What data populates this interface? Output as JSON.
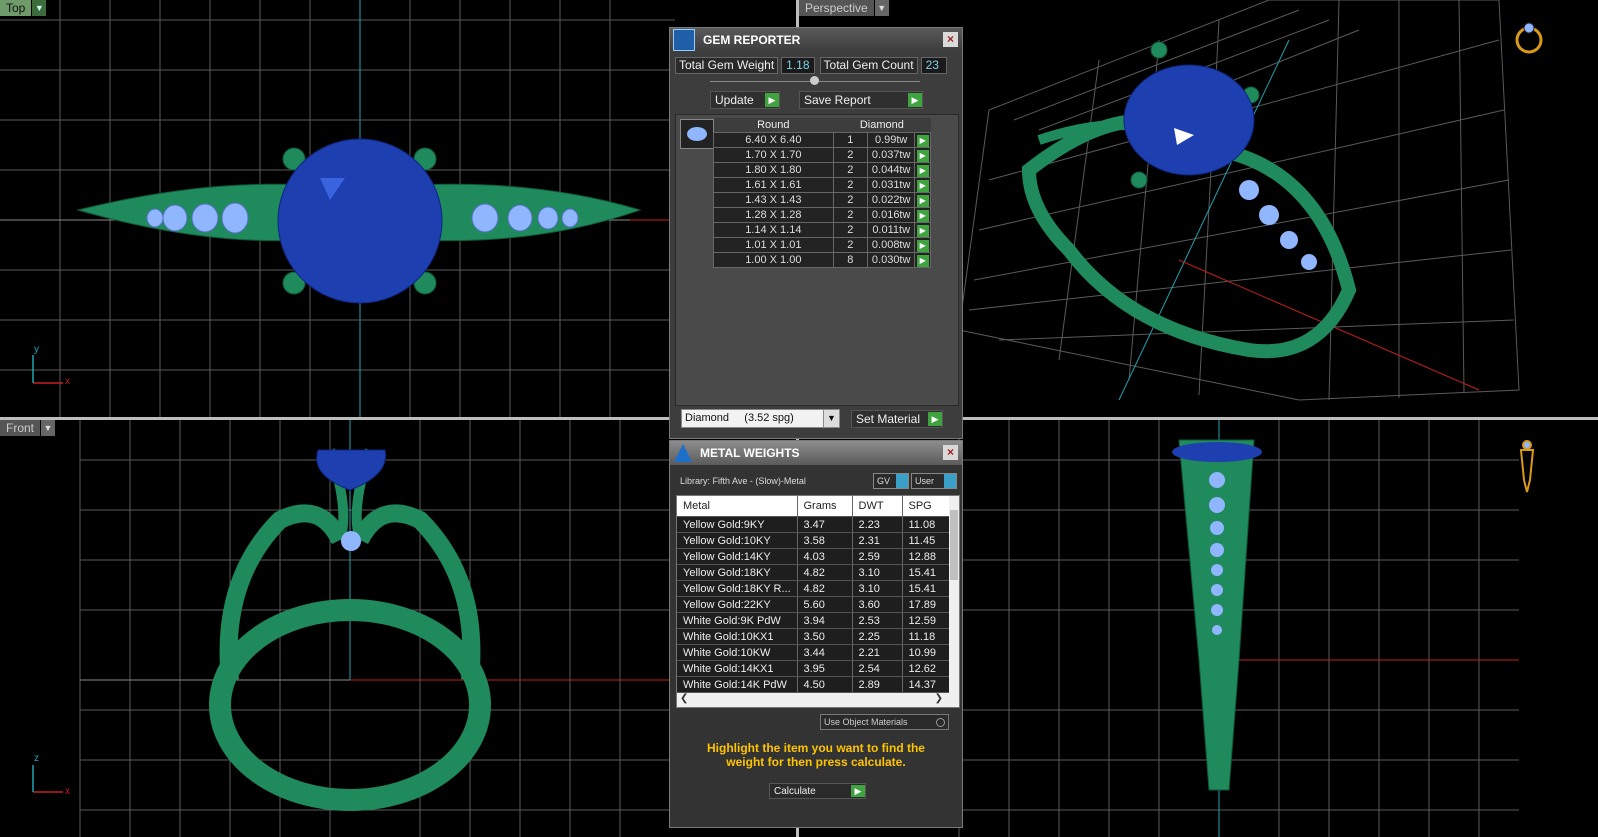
{
  "viewports": {
    "top": {
      "label": "Top",
      "axis_x": "x",
      "axis_y": "y"
    },
    "perspective": {
      "label": "Perspective"
    },
    "front": {
      "label": "Front",
      "axis_x": "x",
      "axis_y": "z"
    },
    "right": {
      "label": ""
    }
  },
  "gem_reporter": {
    "title": "GEM REPORTER",
    "total_weight_label": "Total Gem Weight",
    "total_weight_value": "1.18",
    "total_count_label": "Total Gem Count",
    "total_count_value": "23",
    "update_label": "Update",
    "save_label": "Save Report",
    "col_shape": "Round",
    "col_material": "Diamond",
    "rows": [
      {
        "size": "6.40 X 6.40",
        "count": "1",
        "weight": "0.99tw"
      },
      {
        "size": "1.70 X 1.70",
        "count": "2",
        "weight": "0.037tw"
      },
      {
        "size": "1.80 X 1.80",
        "count": "2",
        "weight": "0.044tw"
      },
      {
        "size": "1.61 X 1.61",
        "count": "2",
        "weight": "0.031tw"
      },
      {
        "size": "1.43 X 1.43",
        "count": "2",
        "weight": "0.022tw"
      },
      {
        "size": "1.28 X 1.28",
        "count": "2",
        "weight": "0.016tw"
      },
      {
        "size": "1.14 X 1.14",
        "count": "2",
        "weight": "0.011tw"
      },
      {
        "size": "1.01 X 1.01",
        "count": "2",
        "weight": "0.008tw"
      },
      {
        "size": "1.00 X 1.00",
        "count": "8",
        "weight": "0.030tw"
      }
    ],
    "material_select": "Diamond     (3.52 spg)",
    "set_material_label": "Set Material"
  },
  "metal_weights": {
    "title": "METAL WEIGHTS",
    "library": "Library: Fifth Ave - (Slow)-Metal",
    "gv_label": "GV",
    "user_label": "User",
    "columns": [
      "Metal",
      "Grams",
      "DWT",
      "SPG"
    ],
    "rows": [
      [
        "Yellow Gold:9KY",
        "3.47",
        "2.23",
        "11.08"
      ],
      [
        "Yellow Gold:10KY",
        "3.58",
        "2.31",
        "11.45"
      ],
      [
        "Yellow Gold:14KY",
        "4.03",
        "2.59",
        "12.88"
      ],
      [
        "Yellow Gold:18KY",
        "4.82",
        "3.10",
        "15.41"
      ],
      [
        "Yellow Gold:18KY R...",
        "4.82",
        "3.10",
        "15.41"
      ],
      [
        "Yellow Gold:22KY",
        "5.60",
        "3.60",
        "17.89"
      ],
      [
        "White Gold:9K PdW",
        "3.94",
        "2.53",
        "12.59"
      ],
      [
        "White Gold:10KX1",
        "3.50",
        "2.25",
        "11.18"
      ],
      [
        "White Gold:10KW",
        "3.44",
        "2.21",
        "10.99"
      ],
      [
        "White Gold:14KX1",
        "3.95",
        "2.54",
        "12.62"
      ],
      [
        "White Gold:14K PdW",
        "4.50",
        "2.89",
        "14.37"
      ]
    ],
    "use_object_materials": "Use Object Materials",
    "hint": "Highlight the item you want to find the weight for then press calculate.",
    "calculate_label": "Calculate"
  },
  "colors": {
    "metal": "#1f8a5c",
    "gem": "#1e3fb0",
    "grid": "#5a5a5a",
    "panel": "#3d3d3d",
    "accent": "#3fa43f",
    "hint": "#ffc400"
  }
}
